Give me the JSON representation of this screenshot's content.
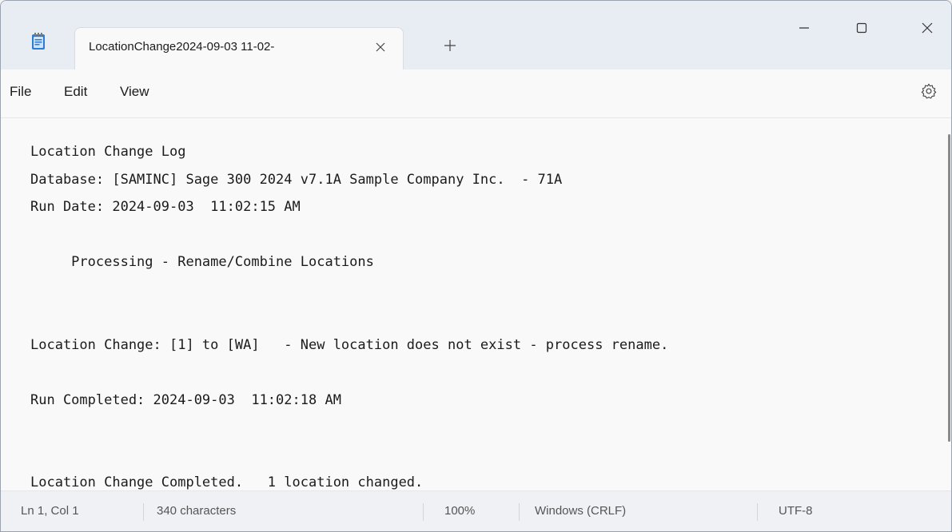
{
  "window": {
    "tab_title": "LocationChange2024-09-03 11-02-",
    "tab_close_icon": "close-icon",
    "new_tab_icon": "plus-icon",
    "minimize_icon": "minimize-icon",
    "maximize_icon": "maximize-icon",
    "close_icon": "close-icon"
  },
  "menu": {
    "file_label": "File",
    "edit_label": "Edit",
    "view_label": "View",
    "settings_icon": "gear-icon"
  },
  "editor": {
    "lines": [
      "Location Change Log",
      "Database: [SAMINC] Sage 300 2024 v7.1A Sample Company Inc.  - 71A",
      "Run Date: 2024-09-03  11:02:15 AM",
      "",
      "     Processing - Rename/Combine Locations",
      "",
      "",
      "Location Change: [1] to [WA]   - New location does not exist - process rename.",
      "",
      "Run Completed: 2024-09-03  11:02:18 AM",
      "",
      "",
      "Location Change Completed.   1 location changed."
    ]
  },
  "status": {
    "position": "Ln 1, Col 1",
    "characters": "340 characters",
    "zoom": "100%",
    "line_ending": "Windows (CRLF)",
    "encoding": "UTF-8"
  },
  "colors": {
    "titlebar_bg": "#e8edf3",
    "editor_bg": "#f9f9f9",
    "statusbar_bg": "#eff1f4",
    "app_icon_blue": "#2b7cd3"
  }
}
